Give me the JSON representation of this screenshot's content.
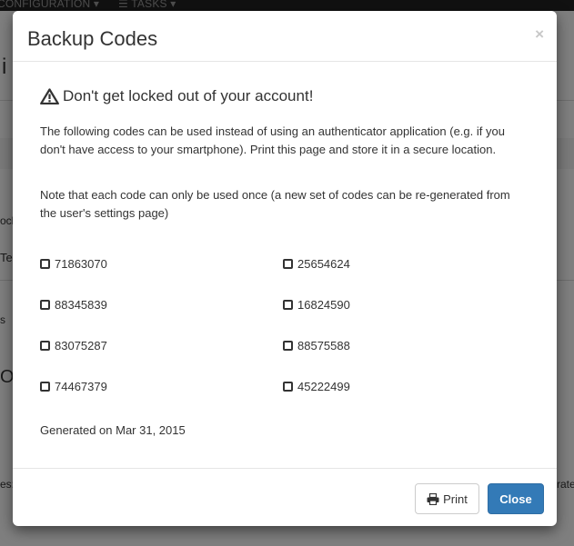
{
  "background": {
    "nav": {
      "configuration": "CONFIGURATION ▾",
      "tasks": "☰ TASKS ▾"
    },
    "fragments": [
      "i",
      "ocl",
      "Te",
      "s",
      "O",
      "es:",
      "rate"
    ]
  },
  "modal": {
    "title": "Backup Codes",
    "close_symbol": "×",
    "warning_heading": "Don't get locked out of your account!",
    "intro_text": "The following codes can be used instead of using an authenticator application (e.g. if you don't have access to your smartphone). Print this page and store it in a secure location.",
    "note_text": "Note that each code can only be used once (a new set of codes can be re-generated from the user's settings page)",
    "codes": [
      "71863070",
      "25654624",
      "88345839",
      "16824590",
      "83075287",
      "88575588",
      "74467379",
      "45222499"
    ],
    "generated_text": "Generated on Mar 31, 2015",
    "footer": {
      "print_label": "Print",
      "close_label": "Close"
    }
  },
  "colors": {
    "primary": "#337ab7",
    "backdrop": "rgba(0,0,0,0.5)",
    "navbar": "#222222"
  },
  "icons": {
    "warning": "warning-triangle-icon",
    "print": "printer-icon",
    "checkbox": "checkbox-icon"
  }
}
